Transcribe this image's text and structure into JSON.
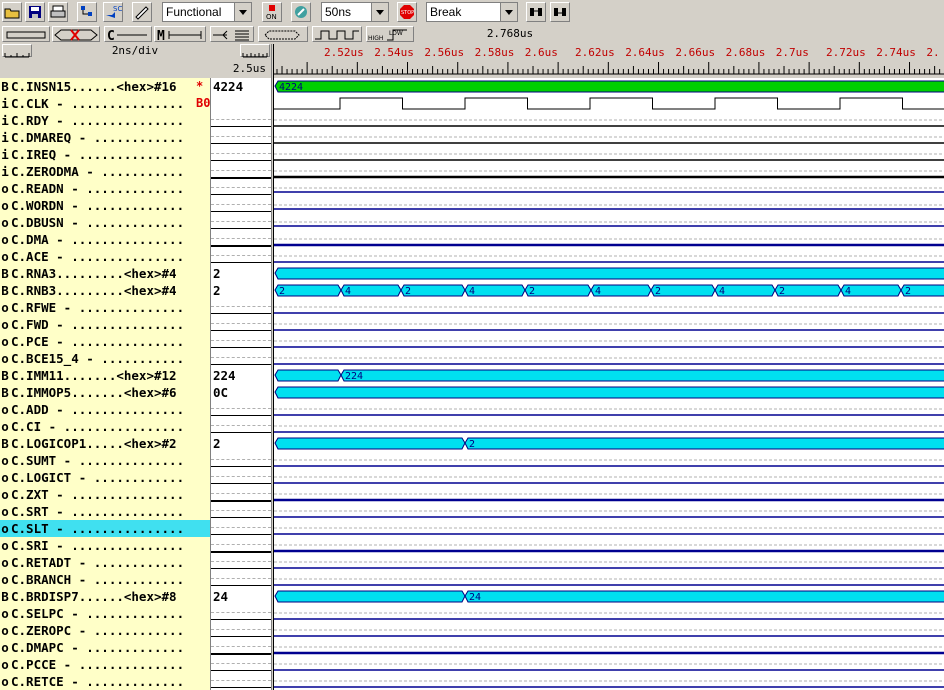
{
  "toolbar": {
    "sim_mode": "Functional",
    "step_size": "50ns",
    "break_mode": "Break",
    "on_label": "ON",
    "stop_label": "STOP",
    "sc_label": "SC",
    "high_label": "HIGH",
    "low_label": "LOW"
  },
  "ruler": {
    "scale": "2ns/div",
    "cursor_time": "2.768us",
    "left_time": "2.5us",
    "ticks": [
      "2.52us",
      "2.54us",
      "2.56us",
      "2.58us",
      "2.6us",
      "2.62us",
      "2.64us",
      "2.66us",
      "2.68us",
      "2.7us",
      "2.72us",
      "2.74us",
      "2."
    ]
  },
  "signals": [
    {
      "dir": "B",
      "label": "C.INSN15......<hex>#16",
      "star": "*",
      "value": "4224",
      "kind": "bus",
      "color": "#00d000",
      "segs": [
        {
          "t": 0,
          "v": "4224"
        }
      ]
    },
    {
      "dir": "i",
      "label": "C.CLK - ...............",
      "star": "B0",
      "value": "",
      "kind": "clock"
    },
    {
      "dir": "i",
      "label": "C.RDY - ...............",
      "star": "",
      "value": "",
      "kind": "low"
    },
    {
      "dir": "i",
      "label": "C.DMAREQ - ............",
      "star": "",
      "value": "",
      "kind": "low"
    },
    {
      "dir": "i",
      "label": "C.IREQ - ..............",
      "star": "",
      "value": "",
      "kind": "low"
    },
    {
      "dir": "i",
      "label": "C.ZERODMA - ...........",
      "star": "",
      "value": "",
      "kind": "lowthick"
    },
    {
      "dir": "o",
      "label": "C.READN - .............",
      "star": "",
      "value": "",
      "kind": "high"
    },
    {
      "dir": "o",
      "label": "C.WORDN - .............",
      "star": "",
      "value": "",
      "kind": "high"
    },
    {
      "dir": "o",
      "label": "C.DBUSN - .............",
      "star": "",
      "value": "",
      "kind": "high"
    },
    {
      "dir": "o",
      "label": "C.DMA - ...............",
      "star": "",
      "value": "",
      "kind": "lowthick"
    },
    {
      "dir": "o",
      "label": "C.ACE - ...............",
      "star": "",
      "value": "",
      "kind": "low"
    },
    {
      "dir": "B",
      "label": "C.RNA3.........<hex>#4",
      "star": "",
      "value": "2",
      "kind": "bus",
      "color": "#00e0f0",
      "segs": [
        {
          "t": 0,
          "v": ""
        }
      ]
    },
    {
      "dir": "B",
      "label": "C.RNB3.........<hex>#4",
      "star": "",
      "value": "2",
      "kind": "bus",
      "color": "#00e0f0",
      "segs": [
        {
          "t": 0,
          "v": "2"
        },
        {
          "t": 66,
          "v": "4"
        },
        {
          "t": 126,
          "v": "2"
        },
        {
          "t": 190,
          "v": "4"
        },
        {
          "t": 250,
          "v": "2"
        },
        {
          "t": 316,
          "v": "4"
        },
        {
          "t": 376,
          "v": "2"
        },
        {
          "t": 440,
          "v": "4"
        },
        {
          "t": 500,
          "v": "2"
        },
        {
          "t": 566,
          "v": "4"
        },
        {
          "t": 626,
          "v": "2"
        }
      ]
    },
    {
      "dir": "o",
      "label": "C.RFWE - ..............",
      "star": "",
      "value": "",
      "kind": "low"
    },
    {
      "dir": "o",
      "label": "C.FWD - ...............",
      "star": "",
      "value": "",
      "kind": "low"
    },
    {
      "dir": "o",
      "label": "C.PCE - ...............",
      "star": "",
      "value": "",
      "kind": "low"
    },
    {
      "dir": "o",
      "label": "C.BCE15_4 - ...........",
      "star": "",
      "value": "",
      "kind": "low"
    },
    {
      "dir": "B",
      "label": "C.IMM11.......<hex>#12",
      "star": "",
      "value": "224",
      "kind": "bus",
      "color": "#00e0f0",
      "segs": [
        {
          "t": 0,
          "v": ""
        },
        {
          "t": 66,
          "v": "224"
        }
      ]
    },
    {
      "dir": "B",
      "label": "C.IMMOP5.......<hex>#6",
      "star": "",
      "value": "0C",
      "kind": "bus",
      "color": "#00e0f0",
      "segs": [
        {
          "t": 0,
          "v": ""
        }
      ]
    },
    {
      "dir": "o",
      "label": "C.ADD - ...............",
      "star": "",
      "value": "",
      "kind": "low"
    },
    {
      "dir": "o",
      "label": "C.CI - ................",
      "star": "",
      "value": "",
      "kind": "low"
    },
    {
      "dir": "B",
      "label": "C.LOGICOP1.....<hex>#2",
      "star": "",
      "value": "2",
      "kind": "bus",
      "color": "#00e0f0",
      "segs": [
        {
          "t": 0,
          "v": ""
        },
        {
          "t": 190,
          "v": "2"
        }
      ]
    },
    {
      "dir": "o",
      "label": "C.SUMT - ..............",
      "star": "",
      "value": "",
      "kind": "low"
    },
    {
      "dir": "o",
      "label": "C.LOGICT - ............",
      "star": "",
      "value": "",
      "kind": "low"
    },
    {
      "dir": "o",
      "label": "C.ZXT - ...............",
      "star": "",
      "value": "",
      "kind": "lowthick"
    },
    {
      "dir": "o",
      "label": "C.SRT - ...............",
      "star": "",
      "value": "",
      "kind": "low"
    },
    {
      "dir": "o",
      "label": "C.SLT - ...............",
      "star": "",
      "value": "",
      "kind": "low",
      "selected": true
    },
    {
      "dir": "o",
      "label": "C.SRI - ...............",
      "star": "",
      "value": "",
      "kind": "lowthick"
    },
    {
      "dir": "o",
      "label": "C.RETADT - ............",
      "star": "",
      "value": "",
      "kind": "low"
    },
    {
      "dir": "o",
      "label": "C.BRANCH - ............",
      "star": "",
      "value": "",
      "kind": "low"
    },
    {
      "dir": "B",
      "label": "C.BRDISP7......<hex>#8",
      "star": "",
      "value": "24",
      "kind": "bus",
      "color": "#00e0f0",
      "segs": [
        {
          "t": 0,
          "v": ""
        },
        {
          "t": 190,
          "v": "24"
        }
      ]
    },
    {
      "dir": "o",
      "label": "C.SELPC - .............",
      "star": "",
      "value": "",
      "kind": "low"
    },
    {
      "dir": "o",
      "label": "C.ZEROPC - ............",
      "star": "",
      "value": "",
      "kind": "low"
    },
    {
      "dir": "o",
      "label": "C.DMAPC - .............",
      "star": "",
      "value": "",
      "kind": "lowthick"
    },
    {
      "dir": "o",
      "label": "C.PCCE - ..............",
      "star": "",
      "value": "",
      "kind": "low"
    },
    {
      "dir": "o",
      "label": "C.RETCE - .............",
      "star": "",
      "value": "",
      "kind": "low"
    }
  ]
}
